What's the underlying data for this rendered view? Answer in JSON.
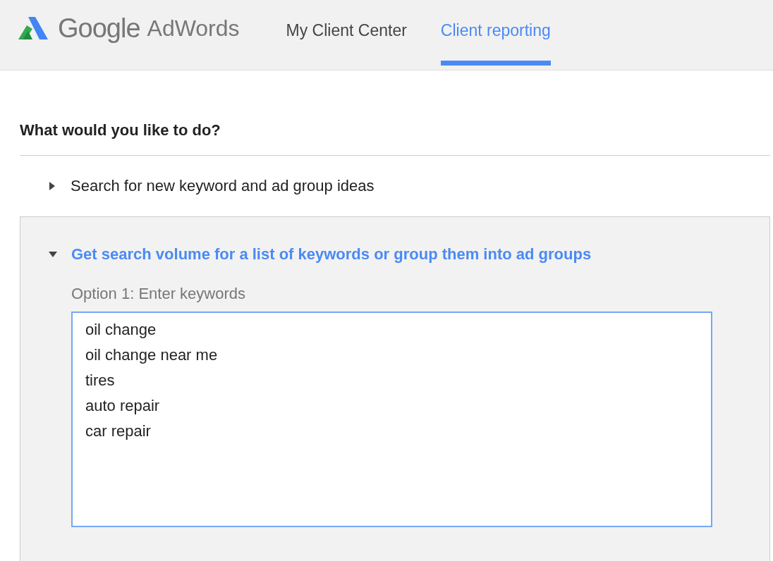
{
  "header": {
    "logo": {
      "brand": "Google",
      "product": "AdWords"
    },
    "tabs": [
      {
        "label": "My Client Center",
        "selected": false
      },
      {
        "label": "Client reporting",
        "selected": true
      }
    ]
  },
  "heading": "What would you like to do?",
  "options": [
    {
      "label": "Search for new keyword and ad group ideas",
      "expanded": false
    },
    {
      "label": "Get search volume for a list of keywords or group them into ad groups",
      "expanded": true,
      "field_label": "Option 1: Enter keywords",
      "keywords": "oil change\noil change near me\ntires\nauto repair\ncar repair"
    }
  ]
}
